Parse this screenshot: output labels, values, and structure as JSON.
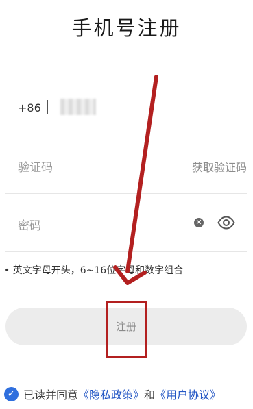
{
  "page": {
    "title": "手机号注册"
  },
  "phone": {
    "country_code": "+86",
    "separator": "|"
  },
  "code": {
    "placeholder": "验证码",
    "get_code_label": "获取验证码"
  },
  "password": {
    "placeholder": "密码",
    "clear_icon": "clear-icon",
    "visibility_icon": "eye-icon"
  },
  "hint": "• 英文字母开头，6~16位字母和数字组合",
  "register": {
    "label": "注册"
  },
  "agreement": {
    "checked": true,
    "prefix": "已读并同意",
    "privacy_label": "《隐私政策》",
    "and": "和",
    "terms_label": "《用户协议》"
  },
  "annotation": {
    "color": "#b32020"
  }
}
